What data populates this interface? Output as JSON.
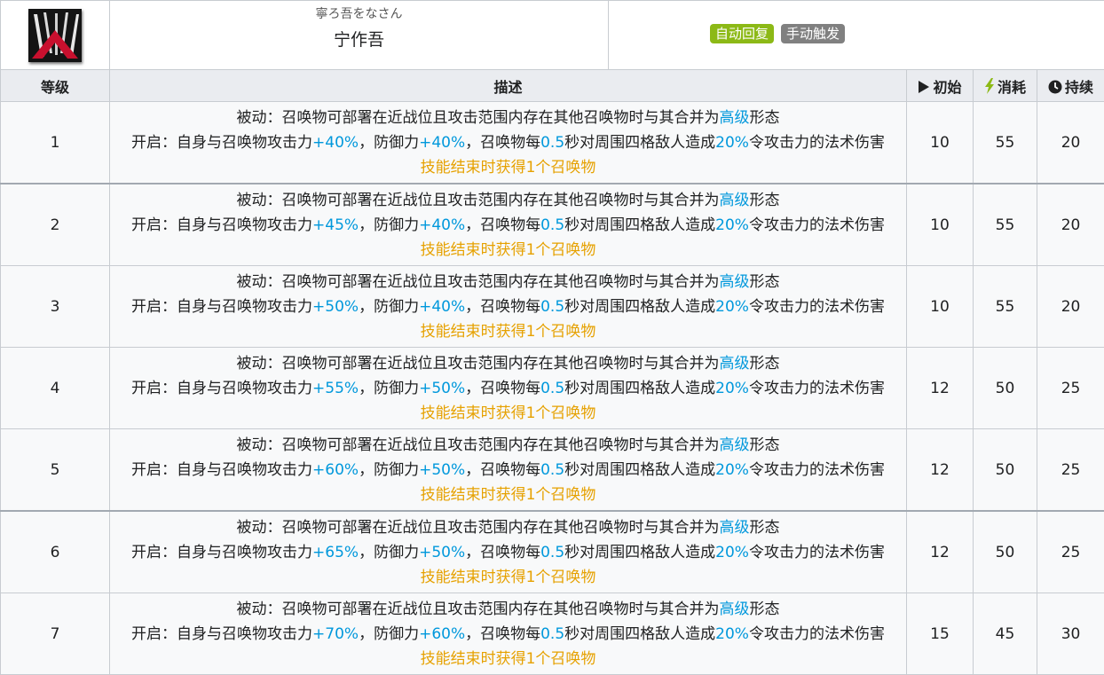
{
  "skill": {
    "name_ruby": "寧ろ吾をなさん",
    "name": "宁作吾",
    "badges": [
      "自动回复",
      "手动触发"
    ]
  },
  "headers": {
    "level": "等级",
    "desc": "描述",
    "initial": "初始",
    "cost": "消耗",
    "duration": "持续"
  },
  "levels": [
    {
      "level": "1",
      "passive_a": "被动：召唤物可部署在近战位且攻击范围内存在其他召唤物时与其合并为",
      "passive_hl": "高级",
      "passive_b": "形态",
      "on_a": "开启：自身与召唤物攻击力",
      "atk": "+40%",
      "on_b": "，防御力",
      "def": "+40%",
      "on_c": "，召唤物每",
      "interval": "0.5",
      "on_d": "秒对周围四格敌人造成",
      "dmg": "20%",
      "on_e": "令攻击力的法术伤害",
      "end": "技能结束时获得1个召唤物",
      "initial": "10",
      "cost": "55",
      "duration": "20"
    },
    {
      "level": "2",
      "passive_a": "被动：召唤物可部署在近战位且攻击范围内存在其他召唤物时与其合并为",
      "passive_hl": "高级",
      "passive_b": "形态",
      "on_a": "开启：自身与召唤物攻击力",
      "atk": "+45%",
      "on_b": "，防御力",
      "def": "+40%",
      "on_c": "，召唤物每",
      "interval": "0.5",
      "on_d": "秒对周围四格敌人造成",
      "dmg": "20%",
      "on_e": "令攻击力的法术伤害",
      "end": "技能结束时获得1个召唤物",
      "initial": "10",
      "cost": "55",
      "duration": "20"
    },
    {
      "level": "3",
      "passive_a": "被动：召唤物可部署在近战位且攻击范围内存在其他召唤物时与其合并为",
      "passive_hl": "高级",
      "passive_b": "形态",
      "on_a": "开启：自身与召唤物攻击力",
      "atk": "+50%",
      "on_b": "，防御力",
      "def": "+40%",
      "on_c": "，召唤物每",
      "interval": "0.5",
      "on_d": "秒对周围四格敌人造成",
      "dmg": "20%",
      "on_e": "令攻击力的法术伤害",
      "end": "技能结束时获得1个召唤物",
      "initial": "10",
      "cost": "55",
      "duration": "20"
    },
    {
      "level": "4",
      "passive_a": "被动：召唤物可部署在近战位且攻击范围内存在其他召唤物时与其合并为",
      "passive_hl": "高级",
      "passive_b": "形态",
      "on_a": "开启：自身与召唤物攻击力",
      "atk": "+55%",
      "on_b": "，防御力",
      "def": "+50%",
      "on_c": "，召唤物每",
      "interval": "0.5",
      "on_d": "秒对周围四格敌人造成",
      "dmg": "20%",
      "on_e": "令攻击力的法术伤害",
      "end": "技能结束时获得1个召唤物",
      "initial": "12",
      "cost": "50",
      "duration": "25"
    },
    {
      "level": "5",
      "passive_a": "被动：召唤物可部署在近战位且攻击范围内存在其他召唤物时与其合并为",
      "passive_hl": "高级",
      "passive_b": "形态",
      "on_a": "开启：自身与召唤物攻击力",
      "atk": "+60%",
      "on_b": "，防御力",
      "def": "+50%",
      "on_c": "，召唤物每",
      "interval": "0.5",
      "on_d": "秒对周围四格敌人造成",
      "dmg": "20%",
      "on_e": "令攻击力的法术伤害",
      "end": "技能结束时获得1个召唤物",
      "initial": "12",
      "cost": "50",
      "duration": "25"
    },
    {
      "level": "6",
      "passive_a": "被动：召唤物可部署在近战位且攻击范围内存在其他召唤物时与其合并为",
      "passive_hl": "高级",
      "passive_b": "形态",
      "on_a": "开启：自身与召唤物攻击力",
      "atk": "+65%",
      "on_b": "，防御力",
      "def": "+50%",
      "on_c": "，召唤物每",
      "interval": "0.5",
      "on_d": "秒对周围四格敌人造成",
      "dmg": "20%",
      "on_e": "令攻击力的法术伤害",
      "end": "技能结束时获得1个召唤物",
      "initial": "12",
      "cost": "50",
      "duration": "25"
    },
    {
      "level": "7",
      "passive_a": "被动：召唤物可部署在近战位且攻击范围内存在其他召唤物时与其合并为",
      "passive_hl": "高级",
      "passive_b": "形态",
      "on_a": "开启：自身与召唤物攻击力",
      "atk": "+70%",
      "on_b": "，防御力",
      "def": "+60%",
      "on_c": "，召唤物每",
      "interval": "0.5",
      "on_d": "秒对周围四格敌人造成",
      "dmg": "20%",
      "on_e": "令攻击力的法术伤害",
      "end": "技能结束时获得1个召唤物",
      "initial": "15",
      "cost": "45",
      "duration": "30"
    }
  ],
  "colors": {
    "highlight_blue": "#0098dc",
    "highlight_orange": "#e6a100",
    "badge_auto": "#8cb916",
    "badge_manual": "#808080",
    "sp_icon": "#8cb916"
  },
  "icons": {
    "skill": "skill-icon",
    "initial": "play-triangle-icon",
    "cost": "lightning-icon",
    "duration": "clock-icon"
  }
}
